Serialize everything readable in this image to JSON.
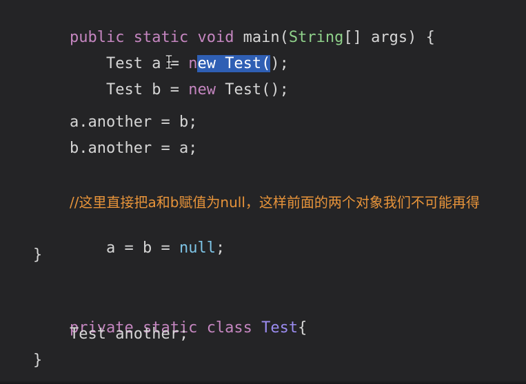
{
  "editor": {
    "main_sig": {
      "t1": "public",
      "t2": " ",
      "t3": "static",
      "t4": " ",
      "t5": "void",
      "t6": " main(",
      "t7": "String",
      "t8": "[] args) {"
    },
    "line_a": {
      "t1": "Test a = ",
      "t2": "n",
      "t3": "ew Test(",
      "t4": ");"
    },
    "line_b": {
      "t1": "Test b = ",
      "t2": "new",
      "t3": " Test();"
    },
    "line_a_another": "a.another = b;",
    "line_b_another": "b.another = a;",
    "comment": "//这里直接把a和b赋值为null，这样前面的两个对象我们不可能再得",
    "line_null": {
      "t1": "a = b = ",
      "t2": "null",
      "t3": ";"
    },
    "close_main": "}",
    "class_sig": {
      "t1": "private",
      "t2": " ",
      "t3": "static",
      "t4": " ",
      "t5": "class",
      "t6": " ",
      "t7": "Test",
      "t8": "{"
    },
    "field": "Test another;",
    "close_class": "}"
  },
  "colors": {
    "background": "#242426",
    "keyword": "#c586c0",
    "string_type": "#8fd18a",
    "class_name": "#9b8cf0",
    "comment": "#e8943a",
    "null_literal": "#7ec4e6",
    "selection": "#2f5fb4"
  },
  "icons": {
    "cursor": "text-cursor-icon"
  }
}
